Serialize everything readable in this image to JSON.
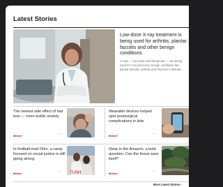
{
  "section": {
    "title": "Latest Stories"
  },
  "hero": {
    "title": "Low-dose X-ray treatment is being used for arthritis, plantar fasciitis and other benign conditions",
    "summary": "X-rays — low dose and therapeutic — are being used for noncancerous, benign conditions like plantar fasciitis, arthritis and Peyronie's disease.",
    "image_icon": "doctor-photo"
  },
  "stories": [
    {
      "title": "The newest side effect of hair loss — more public anxiety",
      "tag": "■News+",
      "more": "···",
      "image_icon": "hair-photo"
    },
    {
      "title": "Wearable devices helped spot postsurgical complications in kids",
      "tag": "■News+",
      "more": "···",
      "image_icon": "phone-photo"
    },
    {
      "title": "In football-mad Ohio, a camp focused on social justice is still going strong",
      "tag": "■News+",
      "more": "···",
      "image_icon": "camp-photo"
    },
    {
      "title": "Deep in the Amazon, a bold question: Can the forest save itself?",
      "tag": "■News+",
      "more": "···",
      "image_icon": "forest-photo"
    }
  ],
  "more_link": "More Latest Stories ›",
  "colors": {
    "accent": "#d0021b",
    "text": "#1d1d1f",
    "secondary": "#6e6e73"
  }
}
